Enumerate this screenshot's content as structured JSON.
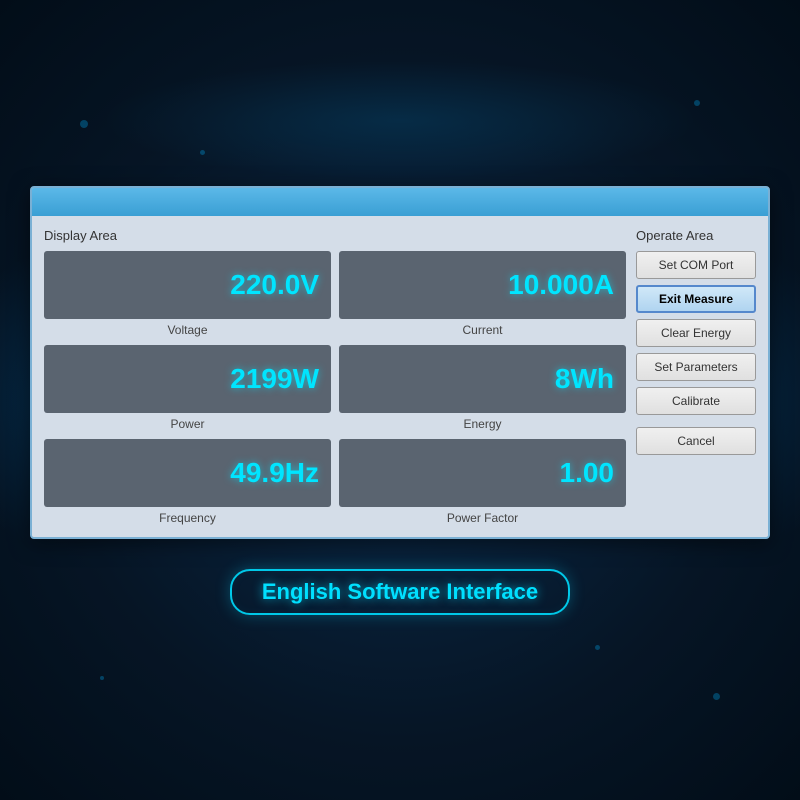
{
  "background": {
    "color": "#061525"
  },
  "window": {
    "display_area_label": "Display Area",
    "operate_area_label": "Operate Area"
  },
  "metrics": [
    {
      "id": "voltage",
      "value": "220.0V",
      "name": "Voltage"
    },
    {
      "id": "current",
      "value": "10.000A",
      "name": "Current"
    },
    {
      "id": "power",
      "value": "2199W",
      "name": "Power"
    },
    {
      "id": "energy",
      "value": "8Wh",
      "name": "Energy"
    },
    {
      "id": "frequency",
      "value": "49.9Hz",
      "name": "Frequency"
    },
    {
      "id": "power-factor",
      "value": "1.00",
      "name": "Power Factor"
    }
  ],
  "buttons": [
    {
      "id": "set-com-port",
      "label": "Set COM Port",
      "active": false
    },
    {
      "id": "exit-measure",
      "label": "Exit Measure",
      "active": true
    },
    {
      "id": "clear-energy",
      "label": "Clear Energy",
      "active": false
    },
    {
      "id": "set-parameters",
      "label": "Set Parameters",
      "active": false
    },
    {
      "id": "calibrate",
      "label": "Calibrate",
      "active": false
    },
    {
      "id": "cancel",
      "label": "Cancel",
      "active": false
    }
  ],
  "bottom_label": "English Software Interface"
}
